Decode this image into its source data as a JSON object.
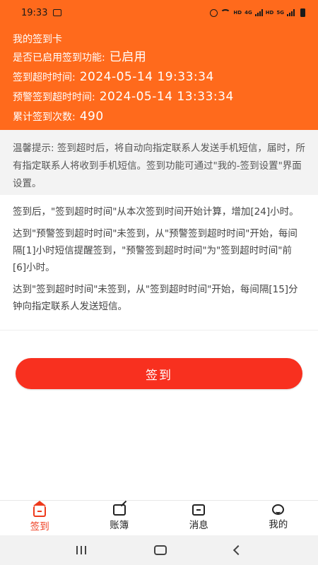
{
  "status_bar": {
    "time": "19:33",
    "network_labels": [
      "HD",
      "4G",
      "HD",
      "5G"
    ]
  },
  "card": {
    "title": "我的签到卡",
    "rows": [
      {
        "label": "是否已启用签到功能:",
        "value": "已启用"
      },
      {
        "label": "签到超时时间:",
        "value": "2024-05-14 19:33:34"
      },
      {
        "label": "预警签到超时时间:",
        "value": "2024-05-14 13:33:34"
      },
      {
        "label": "累计签到次数:",
        "value": "490"
      }
    ],
    "background_color": "#ff6a1c"
  },
  "tip": {
    "text": "温馨提示: 签到超时后，将自动向指定联系人发送手机短信，届时，所有指定联系人将收到手机短信。签到功能可通过\"我的-签到设置\"界面设置。"
  },
  "rules": [
    "签到后，\"签到超时时间\"从本次签到时间开始计算，增加[24]小时。",
    "达到\"预警签到超时时间\"未签到，从\"预警签到超时时间\"开始，每间隔[1]小时短信提醒签到，\"预警签到超时时间\"为\"签到超时时间\"前[6]小时。",
    "达到\"签到超时时间\"未签到，从\"签到超时时间\"开始，每间隔[15]分钟向指定联系人发送短信。"
  ],
  "sign_button": {
    "label": "签到",
    "color": "#f8301f"
  },
  "bottom_nav": {
    "items": [
      {
        "label": "签到",
        "icon": "home-icon",
        "active": true
      },
      {
        "label": "账簿",
        "icon": "edit-book-icon",
        "active": false
      },
      {
        "label": "消息",
        "icon": "message-icon",
        "active": false
      },
      {
        "label": "我的",
        "icon": "profile-icon",
        "active": false
      }
    ],
    "active_color": "#ee3a1c"
  },
  "system_nav": {
    "icons": [
      "recent-apps-icon",
      "home-circle-icon",
      "back-icon"
    ]
  }
}
